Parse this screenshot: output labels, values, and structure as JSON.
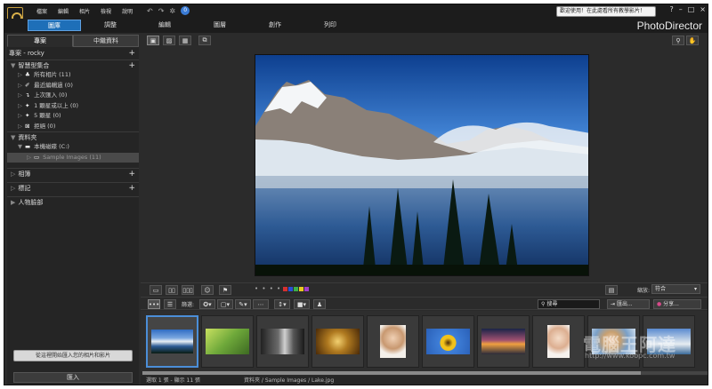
{
  "menu": [
    "檔案",
    "編輯",
    "相片",
    "檢視",
    "說明"
  ],
  "toolbar": {
    "undo_icon": "undo-icon",
    "redo_icon": "redo-icon",
    "settings_icon": "gear-icon",
    "message_count": "0"
  },
  "welcome_text": "歡迎使用！在此處看所有教學影片！",
  "window_controls": [
    "?",
    "–",
    "□",
    "×"
  ],
  "modules": [
    {
      "label": "圖庫",
      "active": true
    },
    {
      "label": "調整",
      "active": false
    },
    {
      "label": "編輯",
      "active": false
    },
    {
      "label": "圖層",
      "active": false
    },
    {
      "label": "創作",
      "active": false
    },
    {
      "label": "列印",
      "active": false
    }
  ],
  "brand": "PhotoDirector",
  "left_panel": {
    "tabs": [
      "專案",
      "中繼資料"
    ],
    "project_label": "專案 - rocky",
    "smart_collections": {
      "title": "智慧型集合",
      "items": [
        "所有相片 (11)",
        "最近編輯過 (0)",
        "上次匯入 (0)",
        "1 顆星或以上 (0)",
        "5 顆星 (0)",
        "拒絕 (0)"
      ]
    },
    "folders": {
      "title": "資料夾",
      "items": [
        {
          "label": "本機磁碟 (C:)",
          "selected": false
        },
        {
          "label": "Sample Images (11)",
          "selected": true
        }
      ]
    },
    "albums": "相簿",
    "tags": "標記",
    "people": "人物臉部",
    "hint_button": "從這裡開始匯入您的相片和影片",
    "import_button": "匯入"
  },
  "view_controls": {
    "fit": "符合",
    "zoom_label": "縮放:",
    "dots": "• • • • •",
    "color_labels": [
      "#d63030",
      "#2a4fd8",
      "#3cb04a",
      "#e8c820",
      "#a040c8"
    ]
  },
  "filter_bar": {
    "filter_label": "篩選:",
    "search_placeholder": "搜尋",
    "export_label": "匯出...",
    "share_label": "分享..."
  },
  "filmstrip": [
    "Lake",
    "Bicycle",
    "Hall",
    "Spiral",
    "Portrait",
    "Sunflower",
    "Sunset",
    "Baby",
    "Woman",
    "Mountains"
  ],
  "status": {
    "selection": "選取 1 張 - 顯示 11 張",
    "path": "資料夾 / Sample Images / Lake.jpg"
  },
  "watermark": {
    "main": "電腦王阿達",
    "sub": "http://www.koopc.com.tw"
  },
  "colors": {
    "accent": "#1e6fb8",
    "panel": "#252525",
    "bg": "#2b2b2b"
  }
}
